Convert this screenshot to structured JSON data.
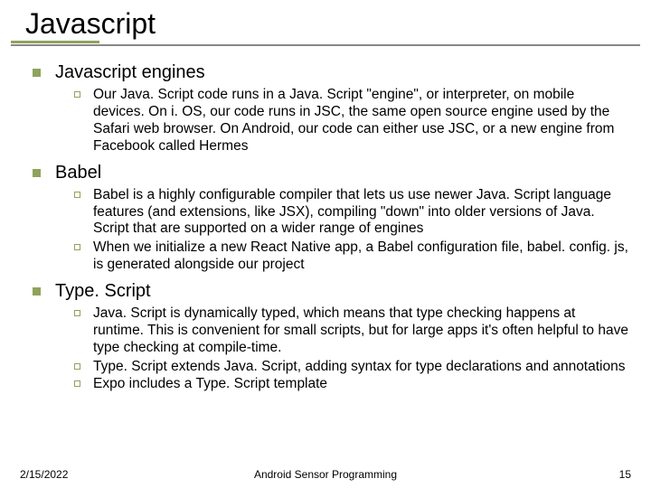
{
  "title": "Javascript",
  "sections": [
    {
      "heading": "Javascript engines",
      "items": [
        "Our Java. Script code runs in a Java. Script \"engine\", or interpreter, on mobile devices. On i. OS, our code runs in JSC, the same open source engine used by the Safari web browser. On Android, our code can either use JSC, or a new engine from Facebook called Hermes"
      ]
    },
    {
      "heading": "Babel",
      "items": [
        "Babel is a highly configurable compiler that lets us use newer Java. Script language features (and extensions, like JSX), compiling \"down\" into older versions of Java. Script that are supported on a wider range of engines",
        "When we initialize a new React Native app, a Babel configuration file, babel. config. js, is generated alongside our project"
      ]
    },
    {
      "heading": "Type. Script",
      "items": [
        "Java. Script is dynamically typed, which means that type checking happens at runtime. This is convenient for small scripts, but for large apps it's often helpful to have type checking at compile-time.",
        "Type. Script extends Java. Script, adding syntax for type declarations and annotations",
        "Expo includes a Type. Script template"
      ]
    }
  ],
  "footer": {
    "date": "2/15/2022",
    "mid": "Android Sensor Programming",
    "page": "15"
  }
}
